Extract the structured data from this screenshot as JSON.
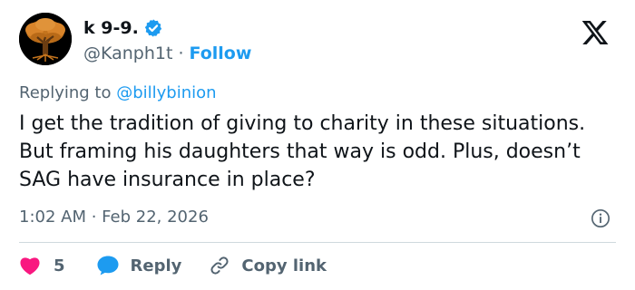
{
  "author": {
    "display_name": "k 9-9.",
    "handle": "@Kanph1t",
    "separator": "·",
    "follow_label": "Follow",
    "verified": true,
    "avatar_icon": "tree-icon"
  },
  "platform_logo": "x-logo-icon",
  "reply_context": {
    "prefix": "Replying to",
    "mention": "@billybinion"
  },
  "tweet": {
    "text": "I get the tradition of giving to charity in these situations. But framing his daughters that way is odd. Plus, doesn’t SAG have insurance in place?",
    "timestamp": "1:02 AM · Feb 22, 2026"
  },
  "actions": {
    "like_count": "5",
    "reply_label": "Reply",
    "copy_link_label": "Copy link"
  },
  "colors": {
    "accent": "#1d9bf0",
    "like": "#f91880",
    "text": "#0f1419",
    "muted": "#536471",
    "divider": "#cfd9de"
  }
}
